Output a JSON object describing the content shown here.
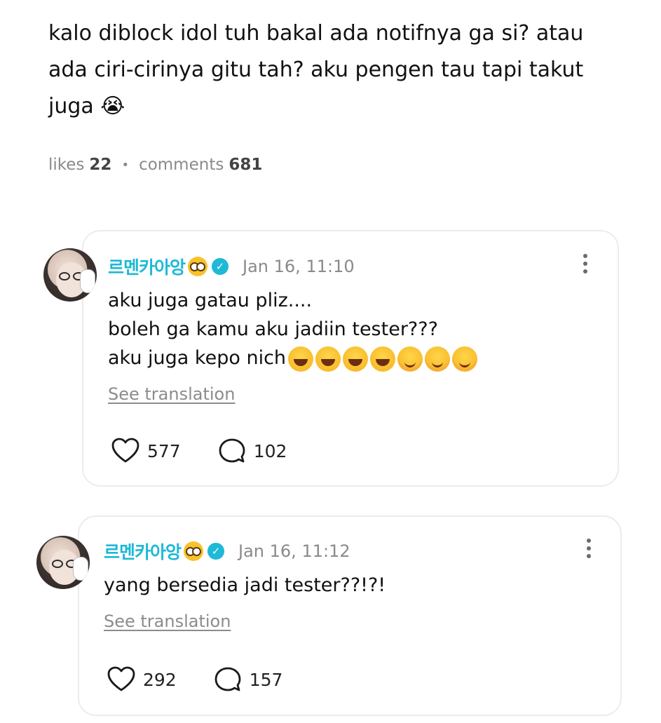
{
  "post": {
    "body": "kalo diblock idol tuh bakal ada notifnya ga si? atau ada ciri-cirinya gitu tah? aku pengen tau tapi takut juga 😭",
    "likes_label": "likes",
    "likes_count": "22",
    "comments_label": "comments",
    "comments_count": "681"
  },
  "comments": [
    {
      "username": "르멘카아앙",
      "timestamp": "Jan 16, 11:10",
      "line1": "aku juga gatau pliz....",
      "line2": "boleh ga kamu aku jadiin tester???",
      "line3": "aku juga kepo nich",
      "translate_label": "See translation",
      "likes": "577",
      "replies": "102"
    },
    {
      "username": "르멘카아앙",
      "timestamp": "Jan 16, 11:12",
      "line1": "yang bersedia jadi tester??!?!",
      "translate_label": "See translation",
      "likes": "292",
      "replies": "157"
    }
  ],
  "icons": {
    "verified": "verified-badge-icon",
    "nerd": "nerd-face-emoji",
    "like": "heart-icon",
    "reply": "comment-bubble-icon",
    "more": "more-vertical-icon"
  },
  "colors": {
    "accent": "#1db9d6",
    "muted": "#8a8a8a"
  }
}
